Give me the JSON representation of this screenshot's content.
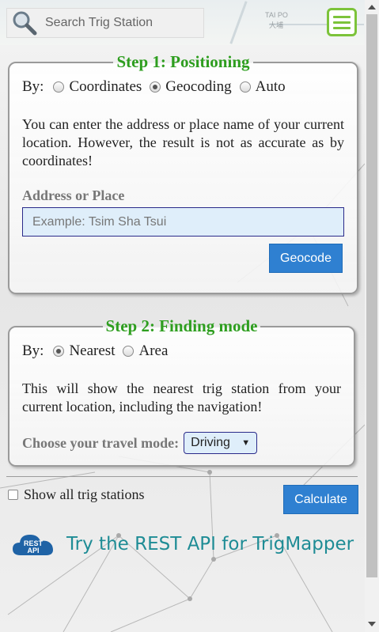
{
  "header": {
    "search_placeholder": "Search Trig Station",
    "map_labels": [
      "TAI PO",
      "大埔"
    ]
  },
  "step1": {
    "title": "Step 1: Positioning",
    "by_label": "By:",
    "options": [
      {
        "label": "Coordinates",
        "selected": false
      },
      {
        "label": "Geocoding",
        "selected": true
      },
      {
        "label": "Auto",
        "selected": false
      }
    ],
    "description": "You can enter the address or place name of your current location. However, the result is not as accurate as by coordinates!",
    "address_label": "Address or Place",
    "address_placeholder": "Example: Tsim Sha Tsui",
    "geocode_button": "Geocode"
  },
  "step2": {
    "title": "Step 2: Finding mode",
    "by_label": "By:",
    "options": [
      {
        "label": "Nearest",
        "selected": true
      },
      {
        "label": "Area",
        "selected": false
      }
    ],
    "description": "This will show the nearest trig station from your current location, including the navigation!",
    "travel_label": "Choose your travel mode:",
    "travel_mode": "Driving"
  },
  "footer": {
    "show_all_label": "Show all trig stations",
    "show_all_checked": false,
    "calculate_button": "Calculate",
    "rest_badge": "REST API",
    "rest_link": "Try the REST API for TrigMapper"
  },
  "colors": {
    "step_title": "#2e9e1f",
    "button": "#2f80d1",
    "menu": "#7cc33a",
    "rest_link": "#1e8c95"
  }
}
